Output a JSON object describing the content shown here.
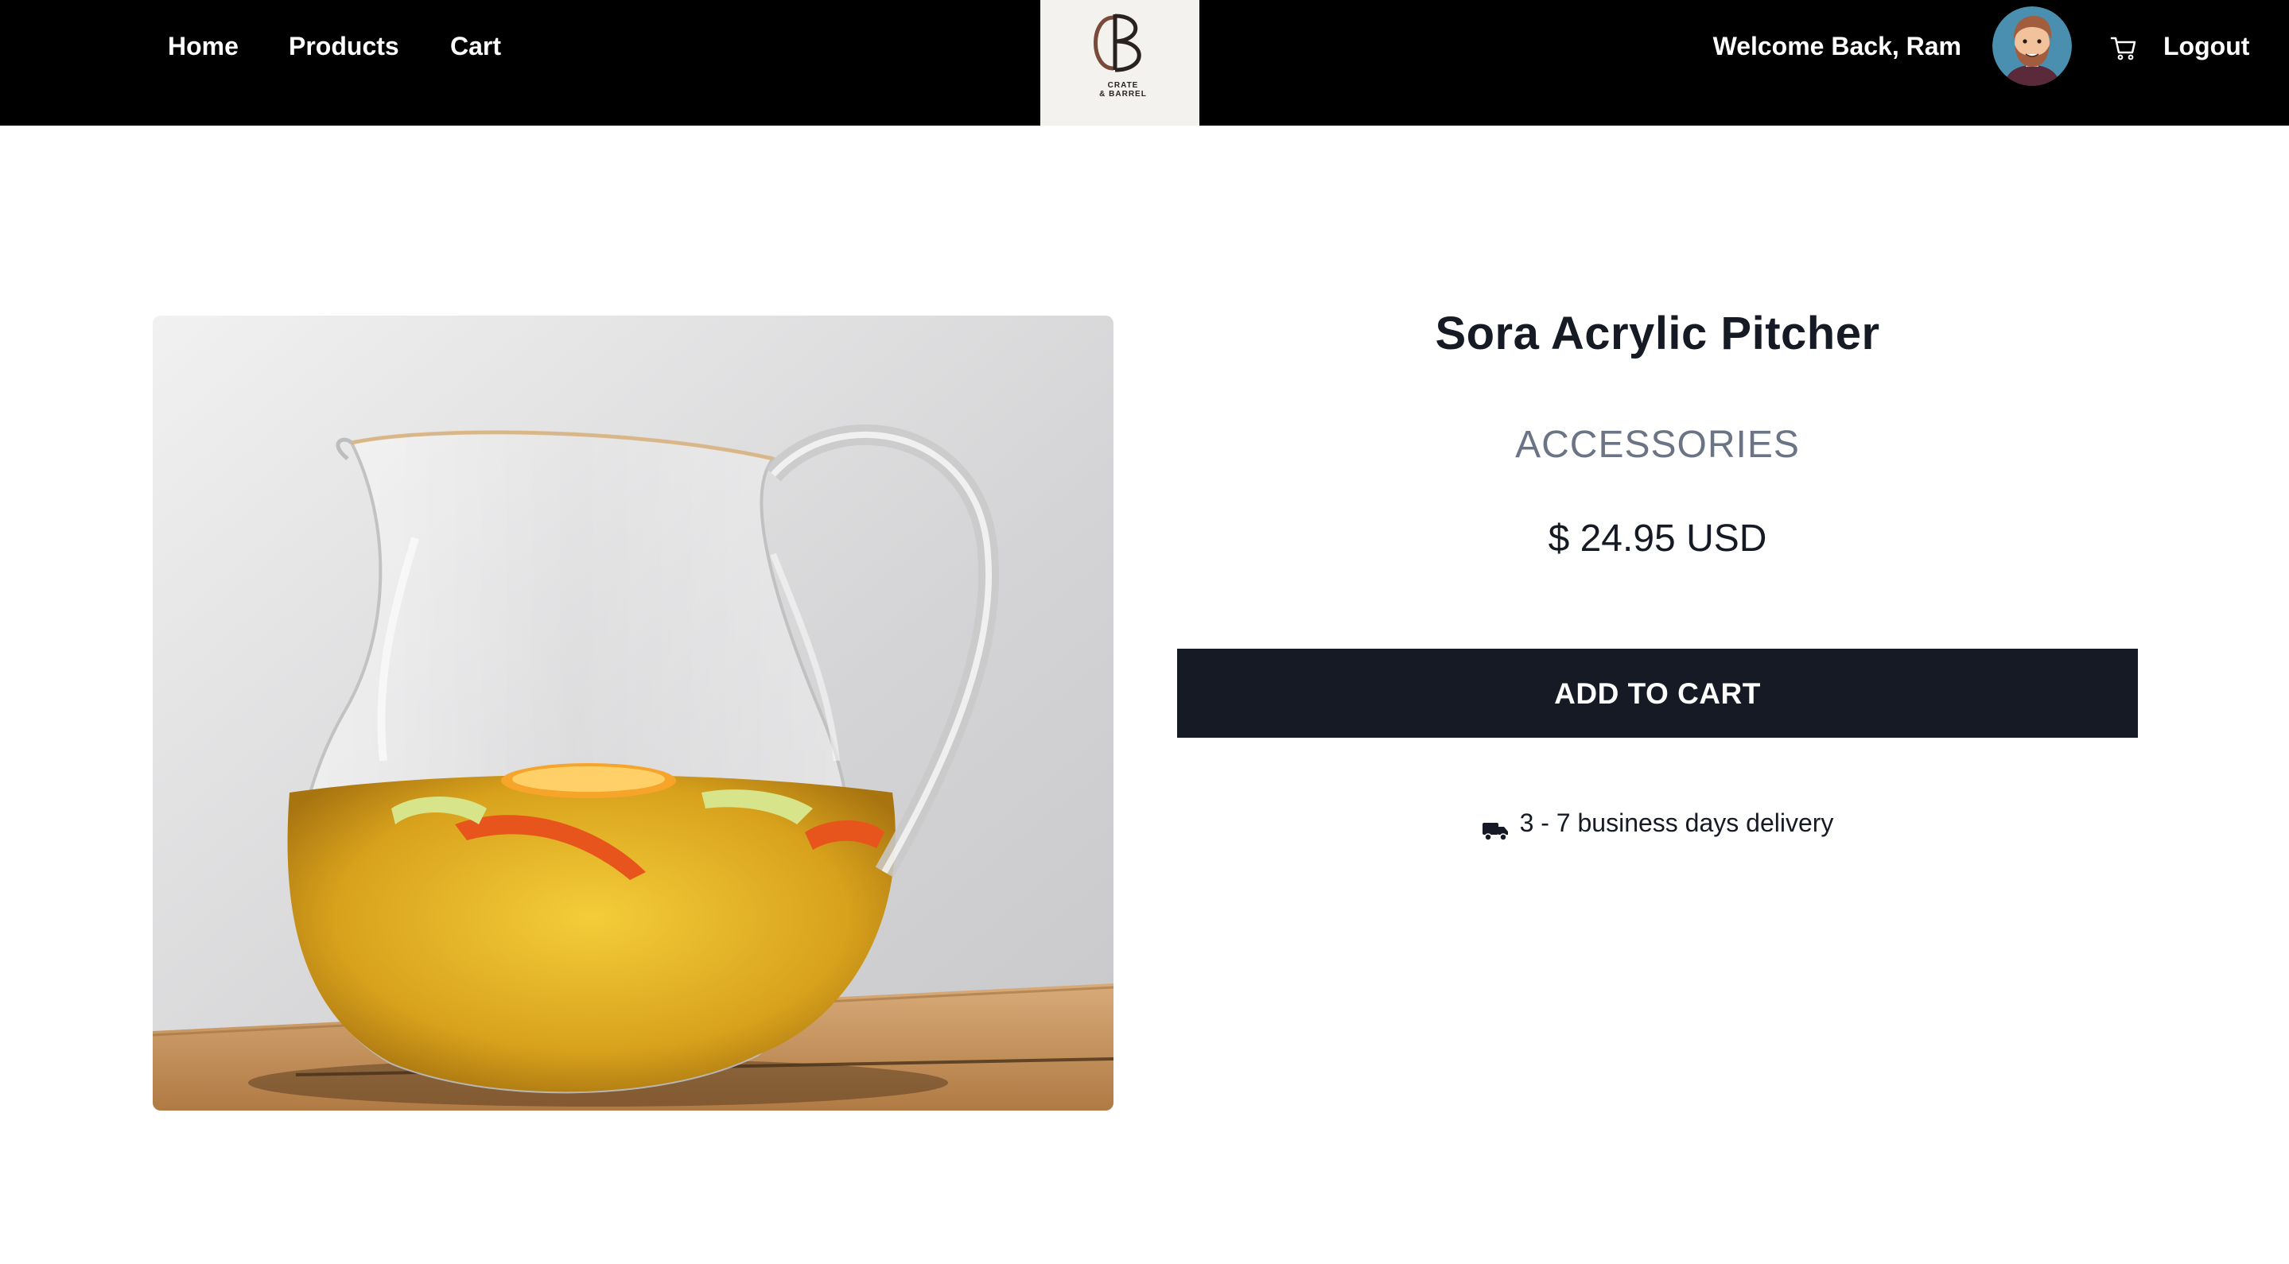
{
  "nav": {
    "home": "Home",
    "products": "Products",
    "cart": "Cart"
  },
  "logo": {
    "monogram": "CB",
    "line1": "CRATE",
    "line2": "& BARREL"
  },
  "user": {
    "welcome": "Welcome Back, Ram",
    "logout": "Logout"
  },
  "icons": {
    "cart": "cart-icon",
    "delivery": "truck-icon",
    "avatar": "avatar"
  },
  "product": {
    "name": "Sora Acrylic Pitcher",
    "category": "ACCESSORIES",
    "price": "$ 24.95 USD",
    "add_to_cart": "ADD TO CART",
    "delivery": "3 - 7 business days delivery",
    "image_alt": "Sora Acrylic Pitcher"
  },
  "colors": {
    "nav_bg": "#000000",
    "button_bg": "#161a24",
    "category_text": "#6b7485"
  }
}
